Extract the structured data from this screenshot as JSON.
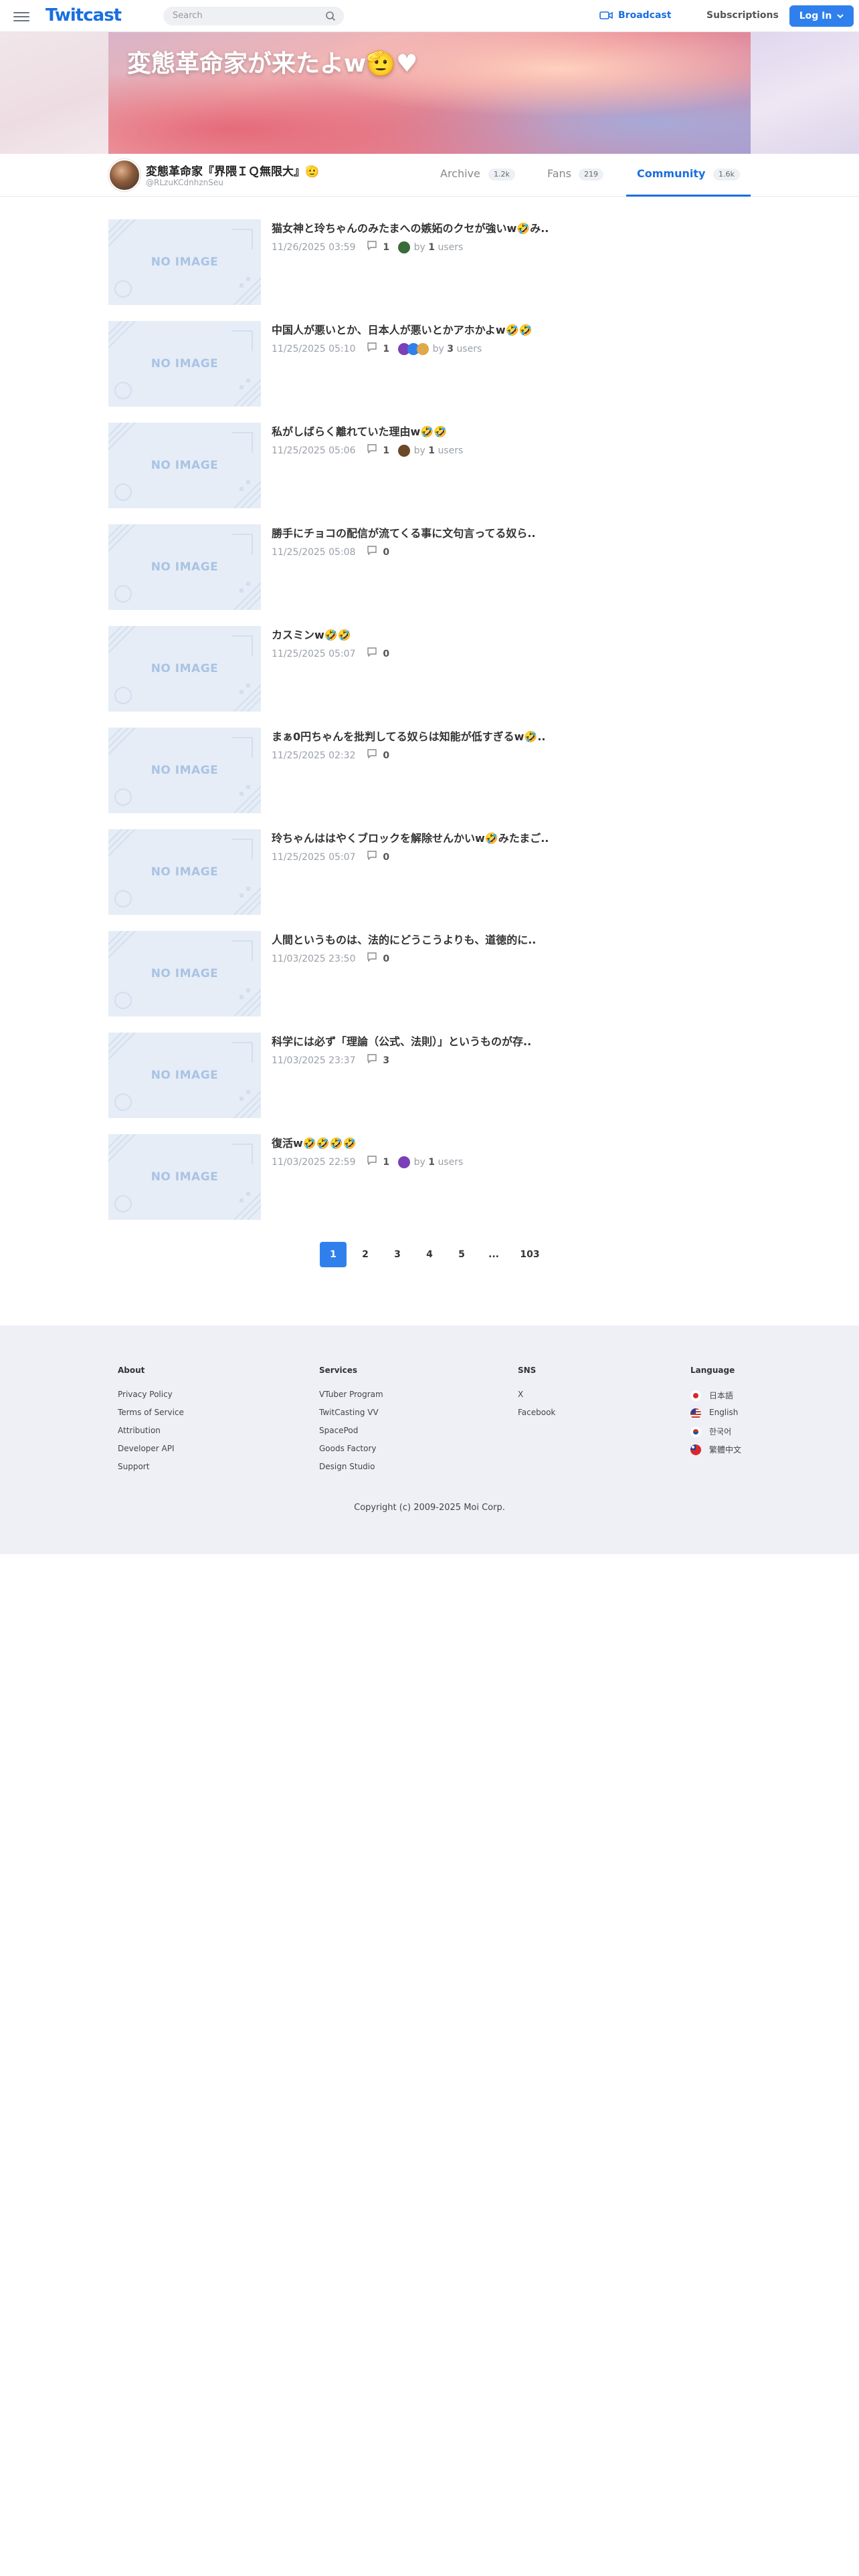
{
  "header": {
    "logo": "Twitcast",
    "search_placeholder": "Search",
    "broadcast_label": "Broadcast",
    "subscriptions_label": "Subscriptions",
    "login_label": "Log In"
  },
  "banner": {
    "title": "変態革命家が来たよw🫡♥"
  },
  "profile": {
    "name": "変態革命家『界隈ＩＱ無限大』🫡",
    "handle": "@RLzuKCdnhznSeu"
  },
  "tabs": [
    {
      "label": "Archive",
      "count": "1.2k"
    },
    {
      "label": "Fans",
      "count": "219"
    },
    {
      "label": "Community",
      "count": "1.6k"
    }
  ],
  "posts": [
    {
      "title": "猫女神と玲ちゃんのみたまへの嫉妬のクセが強いw🤣み..",
      "date": "11/26/2025 03:59",
      "comments": "1",
      "by_users": "1",
      "by_suffix": "users"
    },
    {
      "title": "中国人が悪いとか、日本人が悪いとかアホかよw🤣🤣",
      "date": "11/25/2025 05:10",
      "comments": "1",
      "by_users": "3",
      "by_suffix": "users"
    },
    {
      "title": "私がしばらく離れていた理由w🤣🤣",
      "date": "11/25/2025 05:06",
      "comments": "1",
      "by_users": "1",
      "by_suffix": "users"
    },
    {
      "title": "勝手にチョコの配信が流てくる事に文句言ってる奴ら..",
      "date": "11/25/2025 05:08",
      "comments": "0"
    },
    {
      "title": "カスミンw🤣🤣",
      "date": "11/25/2025 05:07",
      "comments": "0"
    },
    {
      "title": "まぁ0円ちゃんを批判してる奴らは知能が低すぎるw🤣..",
      "date": "11/25/2025 02:32",
      "comments": "0"
    },
    {
      "title": "玲ちゃんははやくブロックを解除せんかいw🤣みたまご..",
      "date": "11/25/2025 05:07",
      "comments": "0"
    },
    {
      "title": "人間というものは、法的にどうこうよりも、道徳的に..",
      "date": "11/03/2025 23:50",
      "comments": "0"
    },
    {
      "title": "科学には必ず「理論（公式、法則）」というものが存..",
      "date": "11/03/2025 23:37",
      "comments": "3"
    },
    {
      "title": "復活w🤣🤣🤣🤣",
      "date": "11/03/2025 22:59",
      "comments": "1",
      "by_users": "1",
      "by_suffix": "users"
    }
  ],
  "no_image_label": "NO IMAGE",
  "by_label": "by",
  "pagination": [
    "1",
    "2",
    "3",
    "4",
    "5",
    "...",
    "103"
  ],
  "footer": {
    "about": {
      "heading": "About",
      "items": [
        "Privacy Policy",
        "Terms of Service",
        "Attribution",
        "Developer API",
        "Support"
      ]
    },
    "services": {
      "heading": "Services",
      "items": [
        "VTuber Program",
        "TwitCasting VV",
        "SpacePod",
        "Goods Factory",
        "Design Studio"
      ]
    },
    "sns": {
      "heading": "SNS",
      "items": [
        "X",
        "Facebook"
      ]
    },
    "language": {
      "heading": "Language",
      "items": [
        "日本語",
        "English",
        "한국어",
        "繁體中文"
      ]
    },
    "copyright": "Copyright (c) 2009-2025 Moi Corp."
  },
  "colors": {
    "brand": "#1a6fe0",
    "button": "#2f80ed"
  }
}
